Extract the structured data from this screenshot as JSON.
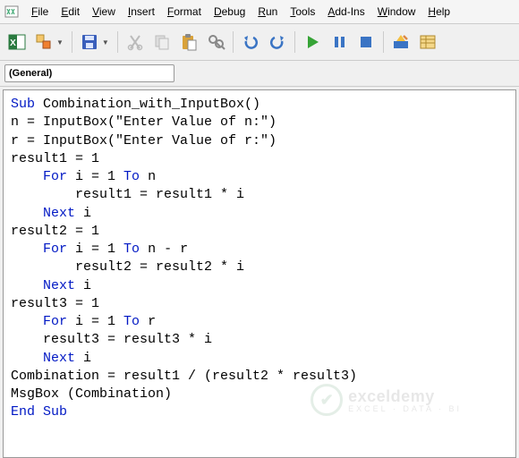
{
  "menu": {
    "items": [
      "File",
      "Edit",
      "View",
      "Insert",
      "Format",
      "Debug",
      "Run",
      "Tools",
      "Add-Ins",
      "Window",
      "Help"
    ]
  },
  "toolbar": {
    "icons": [
      "excel",
      "insert-module",
      "dropdown",
      "save",
      "dropdown",
      "cut",
      "copy",
      "paste",
      "find",
      "undo",
      "redo",
      "run",
      "pause",
      "stop",
      "design",
      "project"
    ]
  },
  "combo": {
    "value": "(General)"
  },
  "code": {
    "lines": [
      {
        "t": "kw",
        "v": "Sub"
      },
      {
        "t": "sp",
        "v": " "
      },
      {
        "t": "",
        "v": "Combination_with_InputBox()"
      },
      {
        "t": "nl"
      },
      {
        "t": "",
        "v": "n = InputBox(\"Enter Value of n:\")"
      },
      {
        "t": "nl"
      },
      {
        "t": "",
        "v": "r = InputBox(\"Enter Value of r:\")"
      },
      {
        "t": "nl"
      },
      {
        "t": "",
        "v": "result1 = 1"
      },
      {
        "t": "nl"
      },
      {
        "t": "sp",
        "v": "    "
      },
      {
        "t": "kw",
        "v": "For"
      },
      {
        "t": "",
        "v": " i = 1 "
      },
      {
        "t": "kw",
        "v": "To"
      },
      {
        "t": "",
        "v": " n"
      },
      {
        "t": "nl"
      },
      {
        "t": "sp",
        "v": "        "
      },
      {
        "t": "",
        "v": "result1 = result1 * i"
      },
      {
        "t": "nl"
      },
      {
        "t": "sp",
        "v": "    "
      },
      {
        "t": "kw",
        "v": "Next"
      },
      {
        "t": "",
        "v": " i"
      },
      {
        "t": "nl"
      },
      {
        "t": "",
        "v": "result2 = 1"
      },
      {
        "t": "nl"
      },
      {
        "t": "sp",
        "v": "    "
      },
      {
        "t": "kw",
        "v": "For"
      },
      {
        "t": "",
        "v": " i = 1 "
      },
      {
        "t": "kw",
        "v": "To"
      },
      {
        "t": "",
        "v": " n - r"
      },
      {
        "t": "nl"
      },
      {
        "t": "sp",
        "v": "        "
      },
      {
        "t": "",
        "v": "result2 = result2 * i"
      },
      {
        "t": "nl"
      },
      {
        "t": "sp",
        "v": "    "
      },
      {
        "t": "kw",
        "v": "Next"
      },
      {
        "t": "",
        "v": " i"
      },
      {
        "t": "nl"
      },
      {
        "t": "",
        "v": "result3 = 1"
      },
      {
        "t": "nl"
      },
      {
        "t": "sp",
        "v": "    "
      },
      {
        "t": "kw",
        "v": "For"
      },
      {
        "t": "",
        "v": " i = 1 "
      },
      {
        "t": "kw",
        "v": "To"
      },
      {
        "t": "",
        "v": " r"
      },
      {
        "t": "nl"
      },
      {
        "t": "sp",
        "v": "    "
      },
      {
        "t": "",
        "v": "result3 = result3 * i"
      },
      {
        "t": "nl"
      },
      {
        "t": "sp",
        "v": "    "
      },
      {
        "t": "kw",
        "v": "Next"
      },
      {
        "t": "",
        "v": " i"
      },
      {
        "t": "nl"
      },
      {
        "t": "",
        "v": "Combination = result1 / (result2 * result3)"
      },
      {
        "t": "nl"
      },
      {
        "t": "",
        "v": "MsgBox (Combination)"
      },
      {
        "t": "nl"
      },
      {
        "t": "kw",
        "v": "End Sub"
      }
    ]
  },
  "watermark": {
    "name": "exceldemy",
    "tag": "EXCEL · DATA · BI"
  }
}
